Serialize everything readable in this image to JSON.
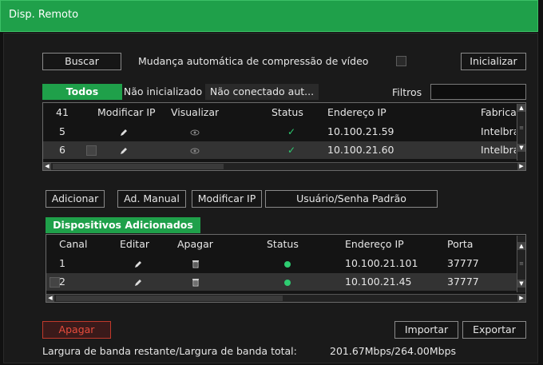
{
  "window": {
    "title": "Disp. Remoto"
  },
  "top": {
    "search_label": "Buscar",
    "auto_compress_label": "Mudança automática de compressão de vídeo",
    "init_label": "Inicializar"
  },
  "filter_tabs": {
    "all": "Todos",
    "not_initialized": "Não inicializado",
    "not_connected": "Não conectado aut...",
    "filters_label": "Filtros",
    "filters_value": ""
  },
  "search_table": {
    "columns": [
      "41",
      "Modificar IP",
      "Visualizar",
      "Status",
      "Endereço IP",
      "Fabrica"
    ],
    "rows": [
      {
        "num": "5",
        "ip": "10.100.21.59",
        "manufacturer": "Intelbra"
      },
      {
        "num": "6",
        "ip": "10.100.21.60",
        "manufacturer": "Intelbra"
      }
    ]
  },
  "actions": {
    "add": "Adicionar",
    "manual_add": "Ad. Manual",
    "modify_ip": "Modificar IP",
    "default_user": "Usuário/Senha Padrão"
  },
  "added_tab": "Dispositivos Adicionados",
  "added_table": {
    "columns": [
      "Canal",
      "Editar",
      "Apagar",
      "Status",
      "Endereço IP",
      "Porta"
    ],
    "rows": [
      {
        "channel": "1",
        "ip": "10.100.21.101",
        "port": "37777"
      },
      {
        "channel": "2",
        "ip": "10.100.21.45",
        "port": "37777"
      }
    ]
  },
  "bottom": {
    "delete": "Apagar",
    "import": "Importar",
    "export": "Exportar",
    "bandwidth_label": "Largura de banda restante/Largura de banda total:",
    "bandwidth_value": "201.67Mbps/264.00Mbps"
  },
  "colors": {
    "accent": "#1fa04a",
    "status_ok": "#2ecc71",
    "danger": "#e74c3c"
  }
}
